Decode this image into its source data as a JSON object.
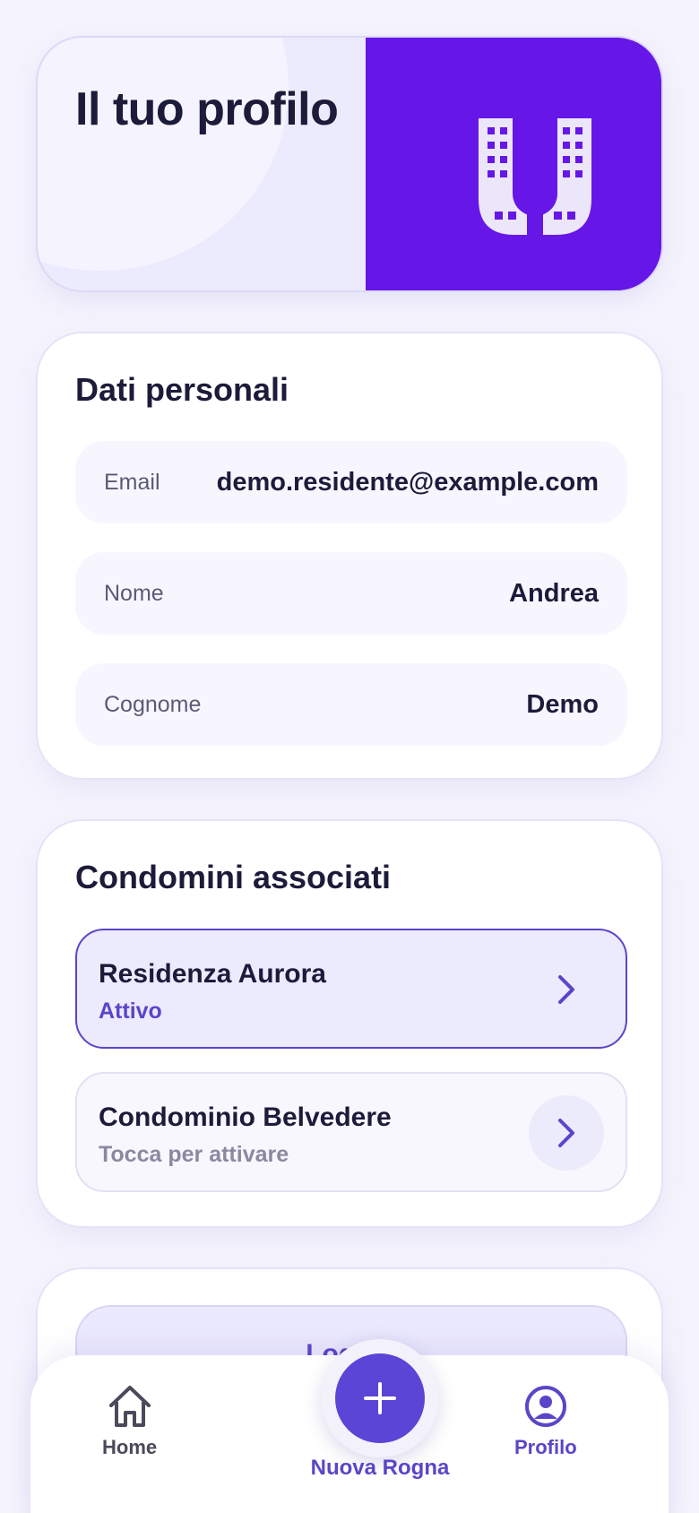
{
  "hero": {
    "title": "Il tuo profilo"
  },
  "personal": {
    "title": "Dati personali",
    "fields": [
      {
        "label": "Email",
        "value": "demo.residente@example.com"
      },
      {
        "label": "Nome",
        "value": "Andrea"
      },
      {
        "label": "Cognome",
        "value": "Demo"
      }
    ]
  },
  "condos": {
    "title": "Condomini associati",
    "items": [
      {
        "name": "Residenza Aurora",
        "status": "Attivo"
      },
      {
        "name": "Condominio Belvedere",
        "status": "Tocca per attivare"
      }
    ]
  },
  "logout": {
    "label": "Logout"
  },
  "nav": {
    "home": "Home",
    "new": "Nuova Rogna",
    "profile": "Profilo"
  },
  "colors": {
    "brand": "#6617e8",
    "accent": "#5b45c8",
    "background": "#f5f4fd"
  }
}
